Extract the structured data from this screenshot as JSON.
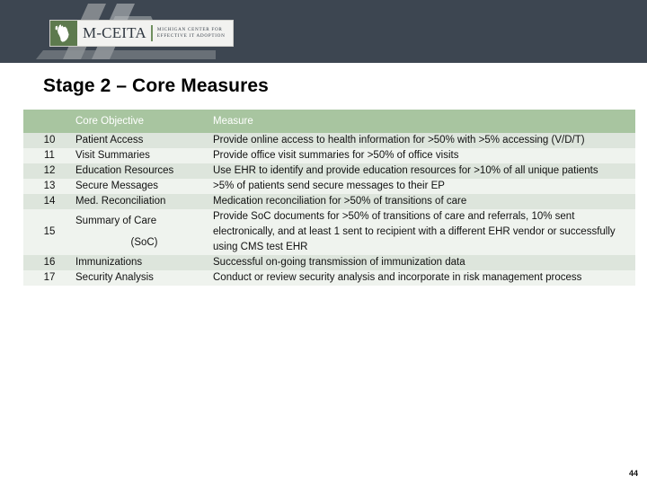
{
  "banner": {
    "background_color": "#3d4651",
    "logo": {
      "mitten_icon": "michigan-mitten-icon",
      "wordmark": "M-CEITA",
      "tagline_line1": "Michigan Center for",
      "tagline_line2": "Effective IT Adoption",
      "accent_color": "#5d7a4e"
    }
  },
  "slide": {
    "title": "Stage 2 – Core Measures",
    "page_number": "44"
  },
  "table": {
    "header_color": "#a8c5a0",
    "row_even_color": "#dde5dc",
    "row_odd_color": "#eff3ee",
    "headers": {
      "number": "",
      "objective": "Core Objective",
      "measure": "Measure"
    },
    "rows": [
      {
        "number": "10",
        "objective": "Patient Access",
        "objective_sub": "",
        "measure": "Provide online access to health information for >50% with >5% accessing (V/D/T)"
      },
      {
        "number": "11",
        "objective": "Visit Summaries",
        "objective_sub": "",
        "measure": "Provide office visit summaries for >50% of office visits"
      },
      {
        "number": "12",
        "objective": "Education Resources",
        "objective_sub": "",
        "measure": "Use EHR to identify and provide education resources for >10% of all unique patients"
      },
      {
        "number": "13",
        "objective": "Secure Messages",
        "objective_sub": "",
        "measure": ">5% of patients send secure messages to their EP"
      },
      {
        "number": "14",
        "objective": "Med. Reconciliation",
        "objective_sub": "",
        "measure": "Medication reconciliation for >50% of transitions of care"
      },
      {
        "number": "15",
        "objective": "Summary of Care",
        "objective_sub": "(SoC)",
        "measure": "Provide SoC documents for >50% of transitions of care and referrals, 10% sent electronically, and at least 1 sent to recipient with a different EHR vendor or successfully using CMS test EHR"
      },
      {
        "number": "16",
        "objective": "Immunizations",
        "objective_sub": "",
        "measure": "Successful on-going transmission of immunization data"
      },
      {
        "number": "17",
        "objective": "Security Analysis",
        "objective_sub": "",
        "measure": "Conduct or review security analysis and incorporate in risk management process"
      }
    ]
  }
}
